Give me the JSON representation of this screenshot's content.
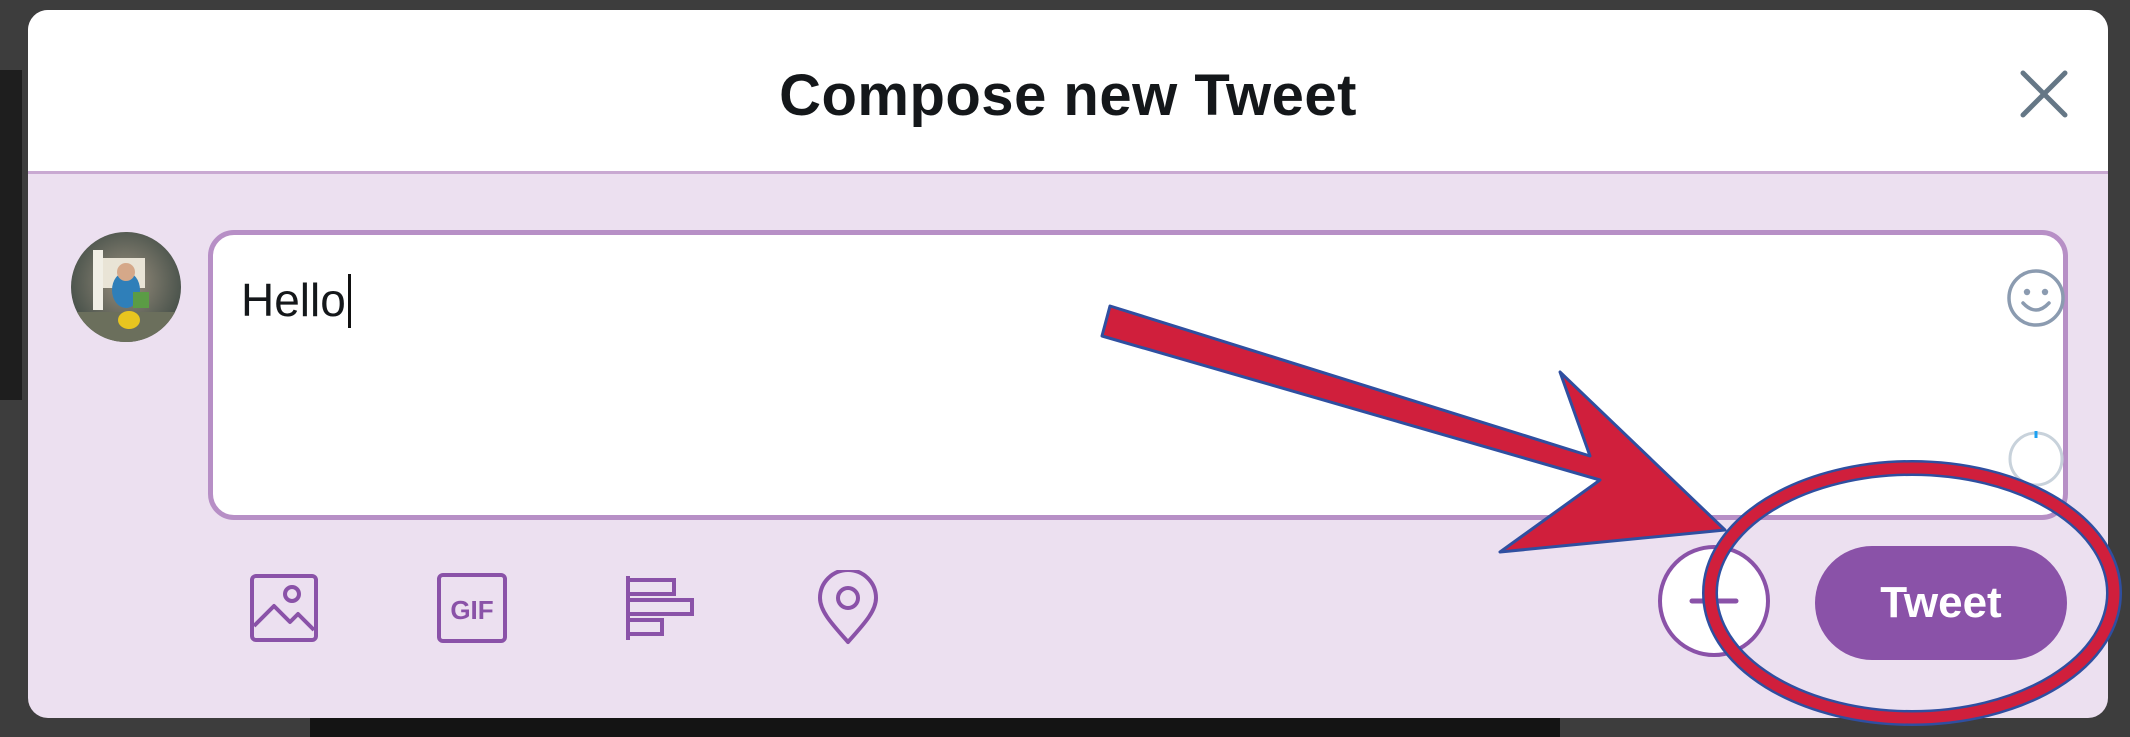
{
  "modal": {
    "title": "Compose new Tweet",
    "close_icon": "close-icon"
  },
  "composer": {
    "text": "Hello",
    "emoji_icon": "smiley-icon",
    "progress": 0.0
  },
  "toolbar": {
    "icons": [
      "image-icon",
      "gif-icon",
      "poll-icon",
      "location-icon"
    ],
    "gif_label": "GIF",
    "add_icon": "plus-icon",
    "tweet_label": "Tweet"
  },
  "colors": {
    "accent": "#8a52a8",
    "composer_border": "#b78fc6",
    "panel_bg": "#ece0f0",
    "annotation_red": "#d01f3c",
    "annotation_outline": "#2f4fa0"
  }
}
